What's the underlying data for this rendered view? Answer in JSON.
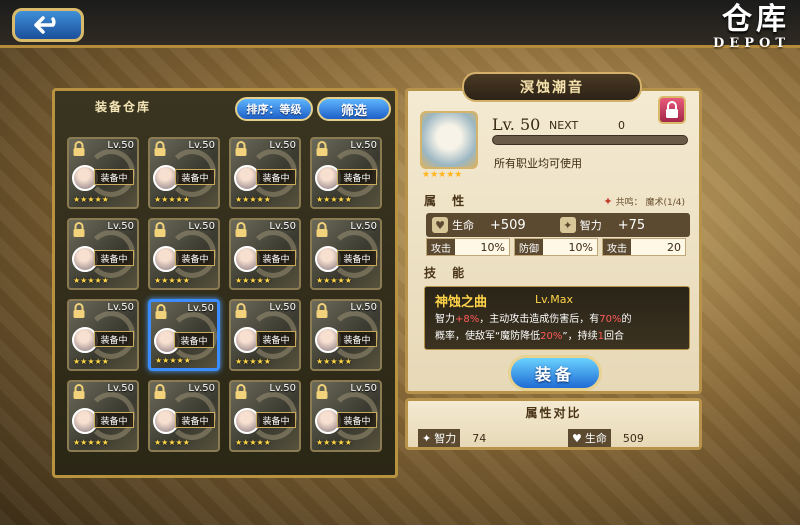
{
  "header": {
    "title_cn": "仓库",
    "title_en": "DEPOT",
    "back_icon": "back-arrow-icon"
  },
  "warehouse": {
    "title": "装备仓库",
    "sort_label": "排序：等级",
    "filter_label": "筛选",
    "items": [
      {
        "level": "Lv.50",
        "status": "装备中",
        "stars": "★★★★★"
      },
      {
        "level": "Lv.50",
        "status": "装备中",
        "stars": "★★★★★"
      },
      {
        "level": "Lv.50",
        "status": "装备中",
        "stars": "★★★★★"
      },
      {
        "level": "Lv.50",
        "status": "装备中",
        "stars": "★★★★★"
      },
      {
        "level": "Lv.50",
        "status": "装备中",
        "stars": "★★★★★"
      },
      {
        "level": "Lv.50",
        "status": "装备中",
        "stars": "★★★★★"
      },
      {
        "level": "Lv.50",
        "status": "装备中",
        "stars": "★★★★★"
      },
      {
        "level": "Lv.50",
        "status": "装备中",
        "stars": "★★★★★"
      },
      {
        "level": "Lv.50",
        "status": "装备中",
        "stars": "★★★★★"
      },
      {
        "level": "Lv.50",
        "status": "装备中",
        "stars": "★★★★★"
      },
      {
        "level": "Lv.50",
        "status": "装备中",
        "stars": "★★★★★"
      },
      {
        "level": "Lv.50",
        "status": "装备中",
        "stars": "★★★★★"
      },
      {
        "level": "Lv.50",
        "status": "装备中",
        "stars": "★★★★★"
      },
      {
        "level": "Lv.50",
        "status": "装备中",
        "stars": "★★★★★"
      },
      {
        "level": "Lv.50",
        "status": "装备中",
        "stars": "★★★★★"
      },
      {
        "level": "Lv.50",
        "status": "装备中",
        "stars": "★★★★★"
      }
    ]
  },
  "detail": {
    "name": "溟蚀潮音",
    "level": "Lv. 50",
    "next_label": "NEXT",
    "next_value": "0",
    "stars": "★★★★★",
    "usable": "所有职业均可使用",
    "attr_title": "属 性",
    "shared_label": "共鸣： 魔术(1/4)",
    "stats": {
      "hp_label": "生命",
      "hp_value": "+509",
      "int_label": "智力",
      "int_value": "+75",
      "atk_label": "攻击",
      "atk_value": "10%",
      "def_label": "防御",
      "def_value": "10%",
      "atk2_label": "攻击",
      "atk2_value": "20"
    },
    "skill_title": "技 能",
    "skill": {
      "name": "神蚀之曲",
      "level": "Lv.Max",
      "desc_a": "智力",
      "desc_b": "+8%",
      "desc_c": "，主动攻击造成伤害后，有",
      "desc_d": "70%",
      "desc_e": "的",
      "desc_f": "概率，使敌军“魔防降低",
      "desc_g": "20%",
      "desc_h": "”，持续",
      "desc_i": "1",
      "desc_j": "回合"
    },
    "equip_label": "装备"
  },
  "compare": {
    "title": "属性对比",
    "int_label": "智力",
    "int_value": "74",
    "hp_label": "生命",
    "hp_value": "509"
  }
}
